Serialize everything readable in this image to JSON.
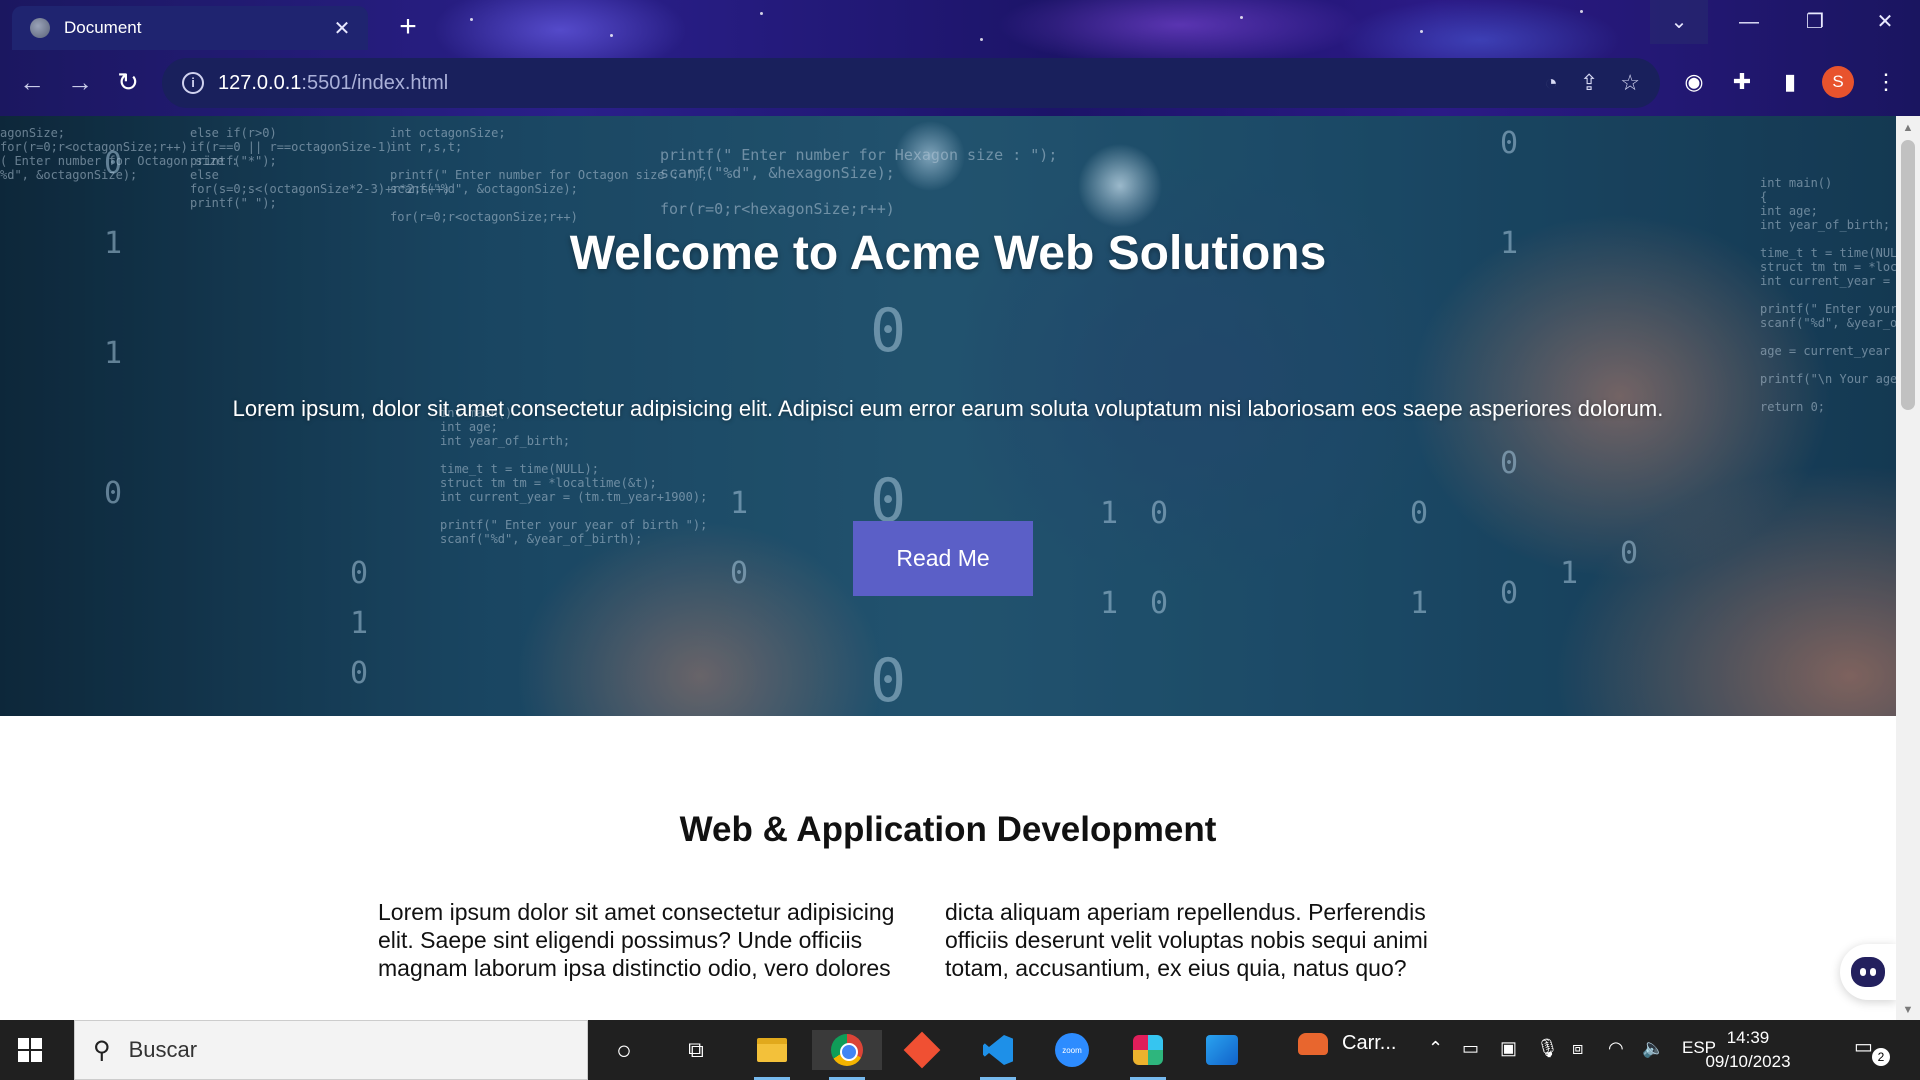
{
  "browser": {
    "tab_title": "Document",
    "tab_close": "✕",
    "new_tab": "+",
    "url_host": "127.0.0.1",
    "url_path": ":5501/index.html",
    "profile_initial": "S",
    "window_controls": {
      "dropdown": "⌄",
      "minimize": "—",
      "maximize": "❐",
      "close": "✕"
    }
  },
  "hero": {
    "title": "Welcome to Acme Web Solutions",
    "text": "Lorem ipsum, dolor sit amet consectetur adipisicing elit. Adipisci eum error earum soluta voluptatum nisi laboriosam eos saepe asperiores dolorum.",
    "button_label": "Read Me",
    "button_color": "#5b5fc7"
  },
  "section": {
    "title": "Web & Application Development",
    "body": "Lorem ipsum dolor sit amet consectetur adipisicing elit. Saepe sint eligendi possimus? Unde officiis magnam laborum ipsa distinctio odio, vero dolores dicta aliquam aperiam repellendus. Perferendis officiis deserunt velit voluptas nobis sequi animi totam, accusantium, ex eius quia, natus quo?"
  },
  "taskbar": {
    "search_placeholder": "Buscar",
    "running_app_label": "Carr...",
    "language": "ESP",
    "time": "14:39",
    "date": "09/10/2023",
    "notification_count": "2",
    "zoom_label": "zoom"
  }
}
